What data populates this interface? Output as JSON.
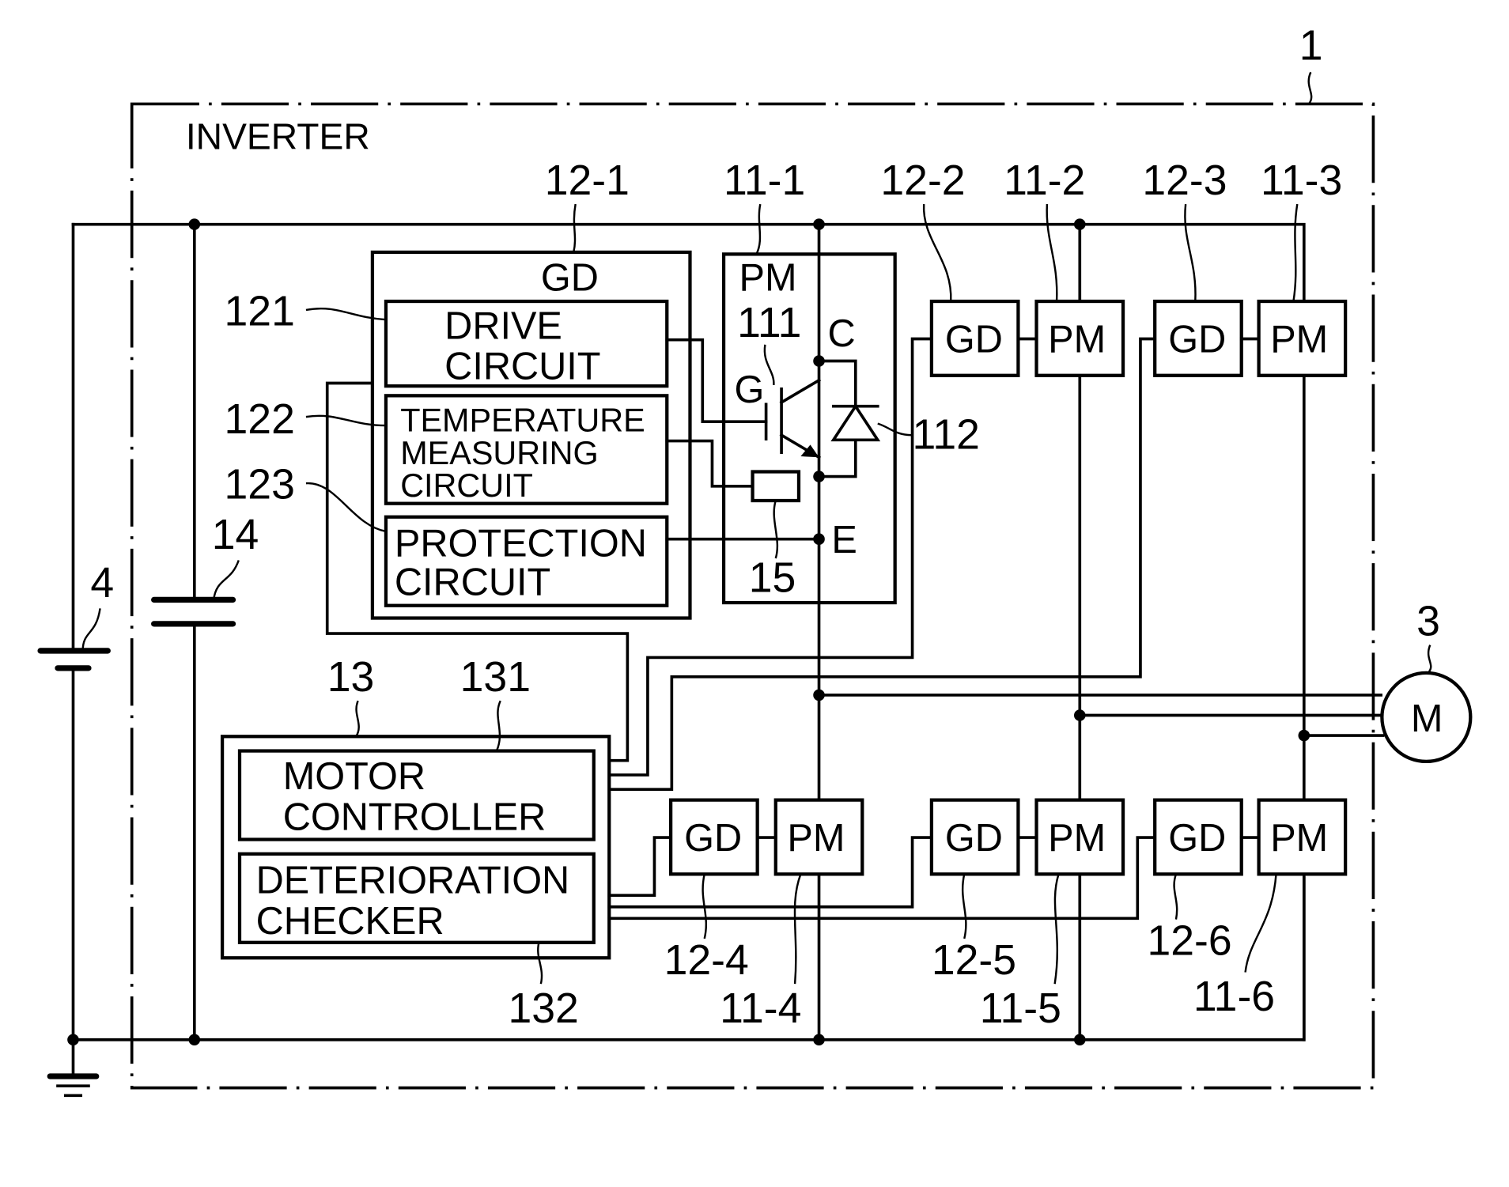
{
  "figure": {
    "system_ref": "1",
    "inverter_label": "INVERTER"
  },
  "battery": {
    "ref": "4"
  },
  "capacitor": {
    "ref": "14"
  },
  "motor": {
    "ref": "3",
    "label": "M"
  },
  "gate_driver_detail": {
    "ref": "12-1",
    "title": "GD",
    "drive_circuit": {
      "ref": "121",
      "line1": "DRIVE",
      "line2": "CIRCUIT"
    },
    "temperature_circuit": {
      "ref": "122",
      "line1": "TEMPERATURE",
      "line2": "MEASURING",
      "line3": "CIRCUIT"
    },
    "protection_circuit": {
      "ref": "123",
      "line1": "PROTECTION",
      "line2": "CIRCUIT"
    }
  },
  "power_module_detail": {
    "ref": "11-1",
    "title": "PM",
    "igbt_ref": "111",
    "diode_ref": "112",
    "sensor_ref": "15",
    "gate_label": "G",
    "collector_label": "C",
    "emitter_label": "E"
  },
  "controller": {
    "ref": "13",
    "motor_controller": {
      "ref": "131",
      "line1": "MOTOR",
      "line2": "CONTROLLER"
    },
    "deterioration_checker": {
      "ref": "132",
      "line1": "DETERIORATION",
      "line2": "CHECKER"
    }
  },
  "modules": {
    "gd_label": "GD",
    "pm_label": "PM",
    "upper": [
      {
        "gd_ref": "12-2",
        "pm_ref": "11-2"
      },
      {
        "gd_ref": "12-3",
        "pm_ref": "11-3"
      }
    ],
    "lower": [
      {
        "gd_ref": "12-4",
        "pm_ref": "11-4"
      },
      {
        "gd_ref": "12-5",
        "pm_ref": "11-5"
      },
      {
        "gd_ref": "12-6",
        "pm_ref": "11-6"
      }
    ]
  }
}
